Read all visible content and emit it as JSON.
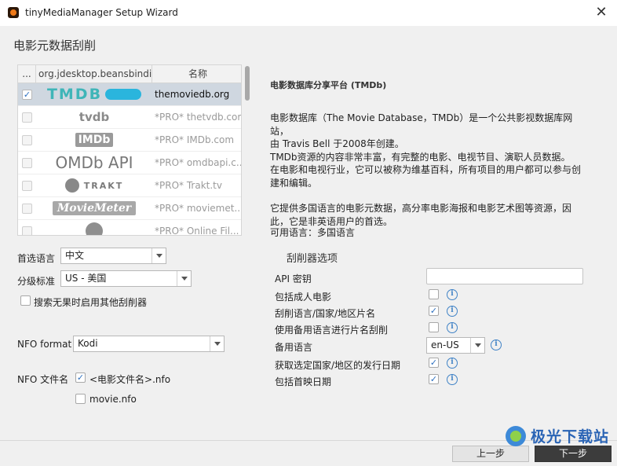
{
  "window": {
    "title": "tinyMediaManager Setup Wizard",
    "close": "✕"
  },
  "heading": "电影元数据刮削",
  "table": {
    "headers": [
      "...",
      "org.jdesktop.beansbindi...",
      "名称"
    ],
    "rows": [
      {
        "checked": true,
        "logo": "TMDB",
        "name": "themoviedb.org"
      },
      {
        "checked": false,
        "logo": "tvdb",
        "name": "*PRO* thetvdb.com"
      },
      {
        "checked": false,
        "logo": "IMDb",
        "name": "*PRO* IMDb.com"
      },
      {
        "checked": false,
        "logo": "OMDb API",
        "name": "*PRO* omdbapi.c..."
      },
      {
        "checked": false,
        "logo": "TRAKT",
        "name": "*PRO* Trakt.tv"
      },
      {
        "checked": false,
        "logo": "MovieMeter",
        "name": "*PRO* moviemet..."
      },
      {
        "checked": false,
        "logo": "",
        "name": "*PRO* Online Fil..."
      }
    ]
  },
  "description": {
    "title": "电影数据库分享平台 (TMDb)",
    "paragraphs": [
      "电影数据库（The Movie Database，TMDb）是一个公共影视数据库网站，\n由 Travis Bell 于2008年创建。\nTMDb资源的内容非常丰富，有完整的电影、电视节目、演职人员数据。\n在电影和电视行业，它可以被称为维基百科，所有项目的用户都可以参与创\n建和编辑。",
      "它提供多国语言的电影元数据，高分率电影海报和电影艺术图等资源，因\n此，它是非英语用户的首选。"
    ],
    "languages": "可用语言：多国语言"
  },
  "left_options": {
    "preferred_language_label": "首选语言",
    "preferred_language_value": "中文",
    "rating_label": "分级标准",
    "rating_value": "US - 美国",
    "fallback_label": "搜索无果时启用其他刮削器",
    "nfo_format_label": "NFO format",
    "nfo_format_value": "Kodi",
    "nfo_file_label": "NFO 文件名",
    "nfo_file_option1": "<电影文件名>.nfo",
    "nfo_file_option1_checked": true,
    "nfo_file_option2": "movie.nfo",
    "nfo_file_option2_checked": false
  },
  "scraper_options": {
    "title": "刮削器选项",
    "api_key_label": "API 密钥",
    "api_key_value": "",
    "include_adult_label": "包括成人电影",
    "scrape_language_names_label": "刮削语言/国家/地区片名",
    "fallback_language_scrape_label": "使用备用语言进行片名刮削",
    "fallback_language_label": "备用语言",
    "fallback_language_value": "en-US",
    "release_date_label": "获取选定国家/地区的发行日期",
    "premiere_date_label": "包括首映日期",
    "checkmark": "✓",
    "info": "i"
  },
  "footer": {
    "prev": "上一步",
    "next": "下一步",
    "watermark": "极光下载站"
  }
}
